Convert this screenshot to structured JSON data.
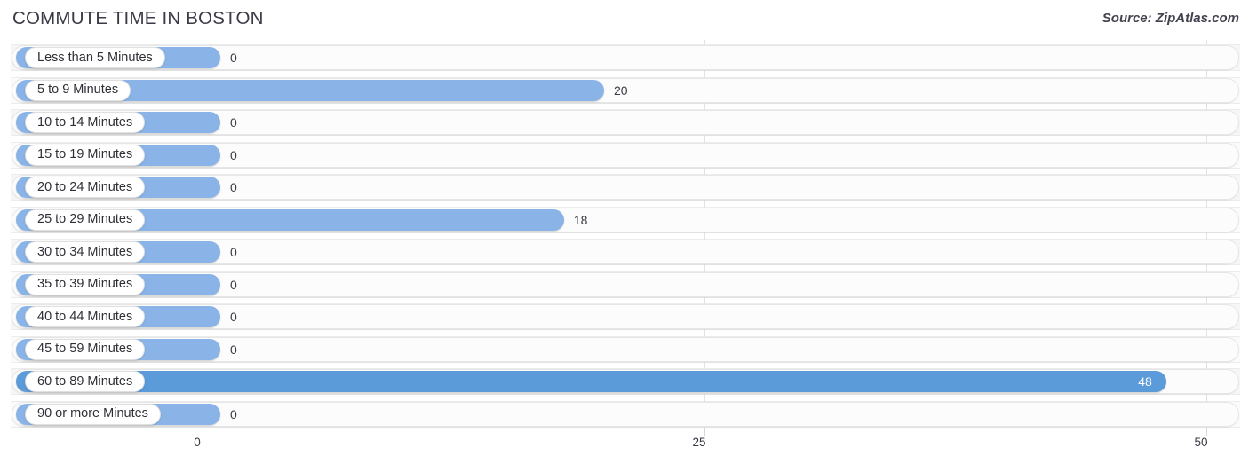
{
  "header": {
    "title": "COMMUTE TIME IN BOSTON",
    "source": "Source: ZipAtlas.com"
  },
  "colors": {
    "bar_light": "#8ab4e8",
    "bar_dark": "#5b9bd9",
    "track": "#fcfcfc",
    "band": "#f6f6f6",
    "gridline": "#e2e2e2",
    "title_text": "#3b3b47",
    "value_text": "#3a3a44",
    "value_text_inside": "#ffffff"
  },
  "chart_data": {
    "type": "bar",
    "orientation": "horizontal",
    "title": "COMMUTE TIME IN BOSTON",
    "xlabel": "",
    "ylabel": "",
    "xlim": [
      0,
      50
    ],
    "grid": true,
    "legend": null,
    "ticks": [
      {
        "value": 0,
        "label": "0"
      },
      {
        "value": 25,
        "label": "25"
      },
      {
        "value": 50,
        "label": "50"
      }
    ],
    "categories": [
      "Less than 5 Minutes",
      "5 to 9 Minutes",
      "10 to 14 Minutes",
      "15 to 19 Minutes",
      "20 to 24 Minutes",
      "25 to 29 Minutes",
      "30 to 34 Minutes",
      "35 to 39 Minutes",
      "40 to 44 Minutes",
      "45 to 59 Minutes",
      "60 to 89 Minutes",
      "90 or more Minutes"
    ],
    "values": [
      0,
      20,
      0,
      0,
      0,
      18,
      0,
      0,
      0,
      0,
      48,
      0
    ],
    "value_labels": [
      "0",
      "20",
      "0",
      "0",
      "0",
      "18",
      "0",
      "0",
      "0",
      "0",
      "48",
      "0"
    ]
  },
  "rows": [
    {
      "label": "Less than 5 Minutes",
      "value": 0,
      "value_label": "0",
      "inside": false,
      "highlight": false
    },
    {
      "label": "5 to 9 Minutes",
      "value": 20,
      "value_label": "20",
      "inside": false,
      "highlight": false
    },
    {
      "label": "10 to 14 Minutes",
      "value": 0,
      "value_label": "0",
      "inside": false,
      "highlight": false
    },
    {
      "label": "15 to 19 Minutes",
      "value": 0,
      "value_label": "0",
      "inside": false,
      "highlight": false
    },
    {
      "label": "20 to 24 Minutes",
      "value": 0,
      "value_label": "0",
      "inside": false,
      "highlight": false
    },
    {
      "label": "25 to 29 Minutes",
      "value": 18,
      "value_label": "18",
      "inside": false,
      "highlight": false
    },
    {
      "label": "30 to 34 Minutes",
      "value": 0,
      "value_label": "0",
      "inside": false,
      "highlight": false
    },
    {
      "label": "35 to 39 Minutes",
      "value": 0,
      "value_label": "0",
      "inside": false,
      "highlight": false
    },
    {
      "label": "40 to 44 Minutes",
      "value": 0,
      "value_label": "0",
      "inside": false,
      "highlight": false
    },
    {
      "label": "45 to 59 Minutes",
      "value": 0,
      "value_label": "0",
      "inside": false,
      "highlight": false
    },
    {
      "label": "60 to 89 Minutes",
      "value": 48,
      "value_label": "48",
      "inside": true,
      "highlight": true
    },
    {
      "label": "90 or more Minutes",
      "value": 0,
      "value_label": "0",
      "inside": false,
      "highlight": false
    }
  ]
}
